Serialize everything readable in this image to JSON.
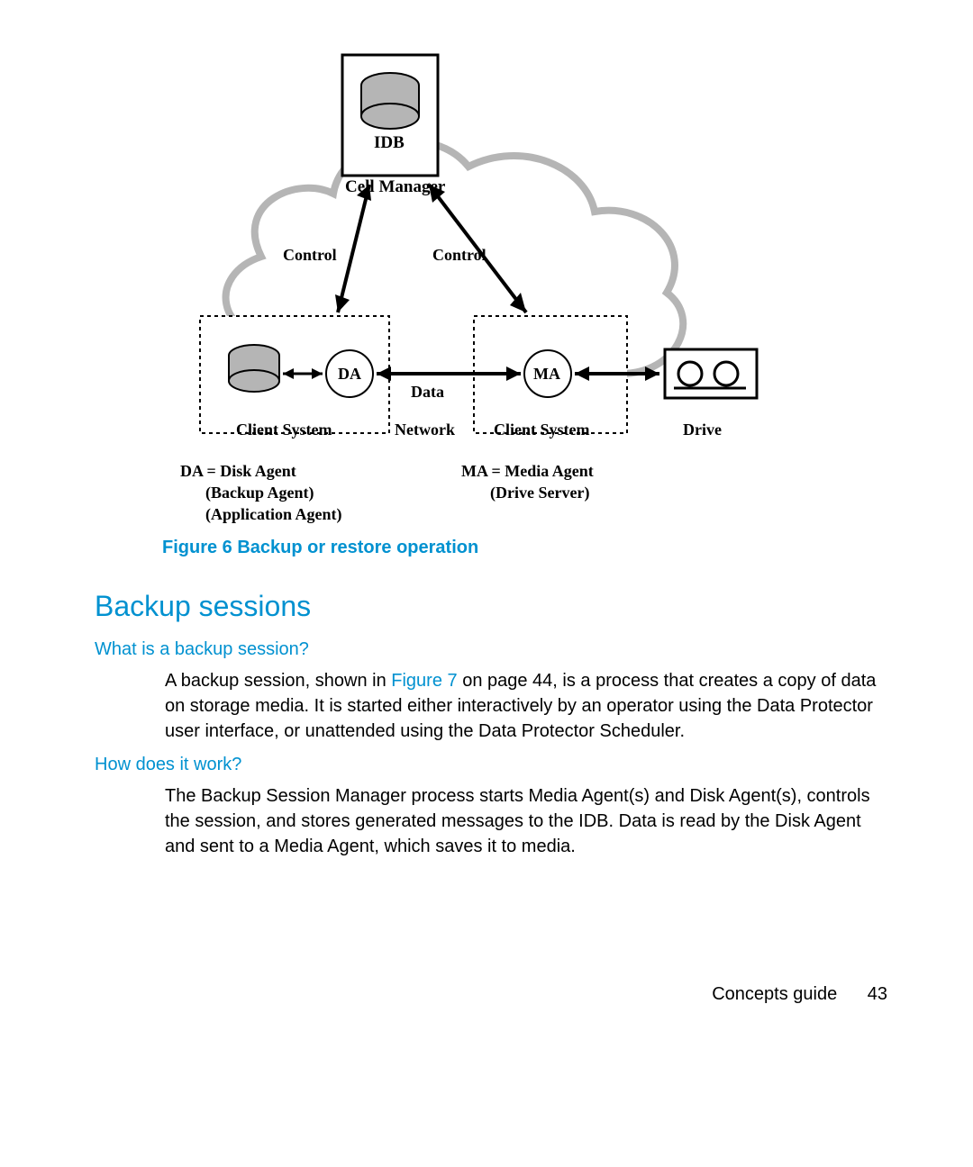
{
  "diagram": {
    "idb": "IDB",
    "cell_manager": "Cell Manager",
    "control_left": "Control",
    "control_right": "Control",
    "da": "DA",
    "ma": "MA",
    "data": "Data",
    "network": "Network",
    "client_system_left": "Client System",
    "client_system_right": "Client System",
    "drive": "Drive",
    "legend_da_title": "DA = Disk Agent",
    "legend_da_line2": "(Backup Agent)",
    "legend_da_line3": "(Application Agent)",
    "legend_ma_title": "MA = Media Agent",
    "legend_ma_line2": "(Drive Server)"
  },
  "figure_caption": "Figure 6 Backup or restore operation",
  "section_heading": "Backup sessions",
  "subheading1": "What is a backup session?",
  "para1_pre": "A backup session, shown in ",
  "para1_link": "Figure 7",
  "para1_post": " on page 44, is a process that creates a copy of data on storage media. It is started either interactively by an operator using the Data Protector user interface, or unattended using the Data Protector Scheduler.",
  "subheading2": "How does it work?",
  "para2": "The Backup Session Manager process starts Media Agent(s) and Disk Agent(s), controls the session, and stores generated messages to the IDB. Data is read by the Disk Agent and sent to a Media Agent, which saves it to media.",
  "footer_title": "Concepts guide",
  "footer_page": "43"
}
